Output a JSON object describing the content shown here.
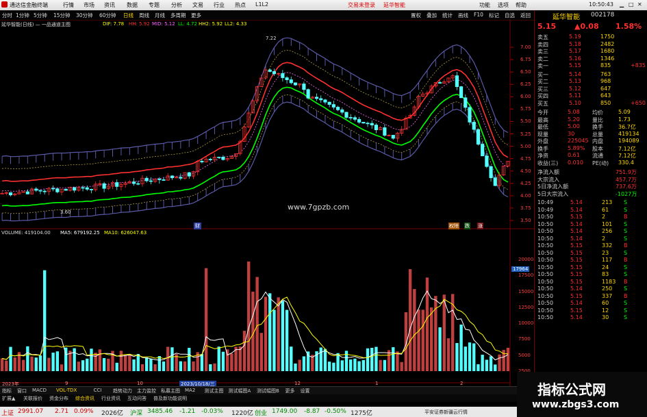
{
  "menubar": {
    "app_title": "通达信金融终端",
    "items": [
      "行情",
      "市场",
      "资讯",
      "数据",
      "专题",
      "分析",
      "文易",
      "行业",
      "热点",
      "L1L2"
    ],
    "login_notice": "交易未登录",
    "account": "延华智能",
    "right_items": [
      "功能",
      "选项",
      "帮助"
    ],
    "clock": "10:50:43"
  },
  "toolbar": {
    "periods": [
      "分时",
      "1分钟",
      "5分钟",
      "15分钟",
      "30分钟",
      "60分钟",
      "日线",
      "周线",
      "月线",
      "多周期",
      "更多"
    ],
    "active_period": "日线",
    "right_buttons": [
      "置权",
      "叠加",
      "统计",
      "画线",
      "F10",
      "标记",
      "自选",
      "返回"
    ]
  },
  "stock": {
    "name": "延华智能",
    "code": "002178",
    "price": "5.15",
    "change": "▲0.08",
    "change_pct": "1.58%"
  },
  "main_chart": {
    "header": "延华智能(日线) — 一品通道主图",
    "indicators": [
      {
        "label": "DIF: 7.78",
        "color": "#ffff00"
      },
      {
        "label": "HH: 5.92",
        "color": "#ff3030"
      },
      {
        "label": "MID: 5.12",
        "color": "#ff66ff"
      },
      {
        "label": "LL: 4.72",
        "color": "#00ff00"
      },
      {
        "label": "HH2: 5.92",
        "color": "#ffff00"
      },
      {
        "label": "LL2: 4.33",
        "color": "#ffff00"
      }
    ],
    "price_axis": [
      "7.00",
      "6.75",
      "6.50",
      "6.25",
      "6.00",
      "5.75",
      "5.50",
      "5.25",
      "5.00",
      "4.75",
      "4.50",
      "4.25",
      "4.00",
      "3.75",
      "3.50"
    ],
    "high_label": "7.22",
    "low_label": "3.60",
    "watermark_url": "www.7gpzb.com",
    "markers": [
      "财",
      "权除",
      "跌",
      "涨"
    ]
  },
  "volume_chart": {
    "header": "VOLUME: 419104.00",
    "ma5": "MA5: 679192.25",
    "ma10": "MA10: 626047.63",
    "axis": [
      "20000",
      "17500",
      "15000",
      "12500",
      "10000",
      "7500",
      "5000",
      "2500"
    ],
    "axis_unit": "万",
    "current_tag": "17964",
    "date_labels": [
      "2023年",
      "9",
      "10",
      "2023/10/18/三",
      "12",
      "1",
      "2"
    ]
  },
  "order_book": {
    "asks": [
      {
        "label": "卖五",
        "price": "5.19",
        "vol": "1750"
      },
      {
        "label": "卖四",
        "price": "5.18",
        "vol": "2482"
      },
      {
        "label": "卖三",
        "price": "5.17",
        "vol": "1680"
      },
      {
        "label": "卖二",
        "price": "5.16",
        "vol": "1346"
      },
      {
        "label": "卖一",
        "price": "5.15",
        "vol": "835",
        "extra": "+835"
      }
    ],
    "bids": [
      {
        "label": "买一",
        "price": "5.14",
        "vol": "763"
      },
      {
        "label": "买二",
        "price": "5.13",
        "vol": "968"
      },
      {
        "label": "买三",
        "price": "5.12",
        "vol": "647"
      },
      {
        "label": "买四",
        "price": "5.11",
        "vol": "643"
      },
      {
        "label": "买五",
        "price": "5.10",
        "vol": "850",
        "extra": "+650"
      }
    ]
  },
  "stats": [
    {
      "l1": "今开",
      "v1": "5.08",
      "l2": "均价",
      "v2": "5.09"
    },
    {
      "l1": "最高",
      "v1": "5.20",
      "l2": "量比",
      "v2": "1.73"
    },
    {
      "l1": "最低",
      "v1": "5.00",
      "l2": "换手",
      "v2": "36.7亿"
    },
    {
      "l1": "现量",
      "v1": "30",
      "l2": "总量",
      "v2": "419134"
    },
    {
      "l1": "外盘",
      "v1": "225045",
      "l2": "内盘",
      "v2": "194089"
    },
    {
      "l1": "换手",
      "v1": "5.89%",
      "l2": "股本",
      "v2": "7.12亿"
    },
    {
      "l1": "净资",
      "v1": "0.61",
      "l2": "流通",
      "v2": "7.12亿"
    },
    {
      "l1": "收益(三)",
      "v1": "0.010",
      "l2": "PE(动)",
      "v2": "330.4"
    }
  ],
  "flows": [
    {
      "label": "净流入额",
      "value": "751.9万"
    },
    {
      "label": "大宗流入",
      "value": "457.7万"
    },
    {
      "label": "5日净流入额",
      "value": "737.6万"
    },
    {
      "label": "5日大宗流入",
      "value": "-1027万"
    }
  ],
  "ticks": [
    {
      "t": "10:49",
      "p": "5.14",
      "v": "213",
      "d": "S"
    },
    {
      "t": "10:49",
      "p": "5.14",
      "v": "61",
      "d": "S"
    },
    {
      "t": "10:50",
      "p": "5.15",
      "v": "2",
      "d": "B"
    },
    {
      "t": "10:50",
      "p": "5.14",
      "v": "101",
      "d": "S"
    },
    {
      "t": "10:50",
      "p": "5.14",
      "v": "256",
      "d": "S"
    },
    {
      "t": "10:50",
      "p": "5.14",
      "v": "2",
      "d": "S"
    },
    {
      "t": "10:50",
      "p": "5.15",
      "v": "332",
      "d": "B"
    },
    {
      "t": "10:50",
      "p": "5.15",
      "v": "23",
      "d": "S"
    },
    {
      "t": "10:50",
      "p": "5.15",
      "v": "117",
      "d": "B"
    },
    {
      "t": "10:50",
      "p": "5.15",
      "v": "24",
      "d": "S"
    },
    {
      "t": "10:50",
      "p": "5.15",
      "v": "83",
      "d": "S"
    },
    {
      "t": "10:50",
      "p": "5.15",
      "v": "1183",
      "d": "B"
    },
    {
      "t": "10:50",
      "p": "5.14",
      "v": "250",
      "d": "S"
    },
    {
      "t": "10:50",
      "p": "5.15",
      "v": "337",
      "d": "B"
    },
    {
      "t": "10:50",
      "p": "5.14",
      "v": "60",
      "d": "S"
    },
    {
      "t": "10:50",
      "p": "5.15",
      "v": "12",
      "d": "S"
    },
    {
      "t": "10:50",
      "p": "5.14",
      "v": "30",
      "d": "S"
    }
  ],
  "bottom_tabs": [
    "指标",
    "窗口",
    "MACD",
    "VOL-TDX",
    "CCI",
    "趋势动力",
    "主力监控",
    "私募主图",
    "MA2",
    "测试主图",
    "测试幅图A",
    "测试幅图B",
    "更多",
    "设置"
  ],
  "bottom_tabs2": [
    "扩展▲",
    "关联报价",
    "资金分布",
    "综合资讯",
    "行业资讯",
    "互动问答",
    "普及新功能说明"
  ],
  "status": {
    "sh_label": "上证",
    "sh_val": "2991.07",
    "sh_chg": "2.71",
    "sh_pct": "0.09%",
    "sh_amt": "2026亿",
    "sz_label": "沪深",
    "sz_val": "3485.46",
    "sz_chg": "-1.21",
    "sz_pct": "-0.03%",
    "sz_amt": "1220亿",
    "cy_label": "创业",
    "cy_val": "1749.00",
    "cy_chg": "-8.87",
    "cy_pct": "-0.50%",
    "cy_amt": "1275亿",
    "broker": "平安证券新疆云行情"
  },
  "site_watermark": {
    "title": "指标公式网",
    "url": "www.zbgs3.com"
  },
  "colors": {
    "up": "#ff3030",
    "down": "#54ffff",
    "bg": "#000000",
    "grid": "#7a0000"
  }
}
